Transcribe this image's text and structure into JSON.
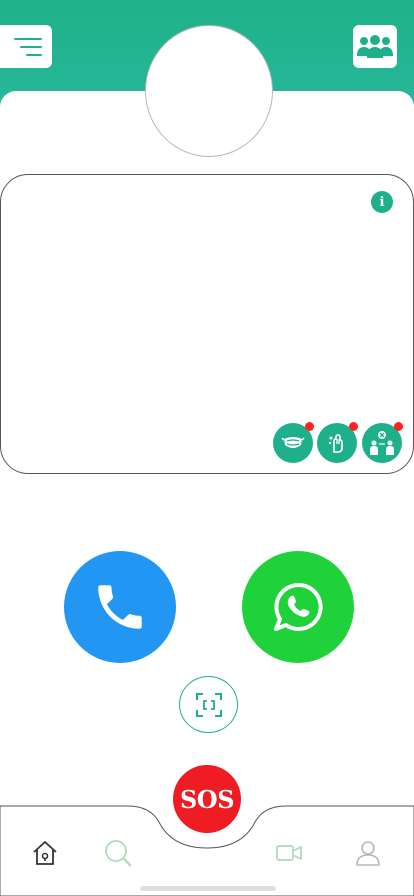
{
  "header": {
    "menu_icon": "menu-icon",
    "group_icon": "group-icon",
    "accent_color": "#1db08a"
  },
  "card": {
    "info_label": "i",
    "features": [
      {
        "icon": "mask-icon",
        "badge": "red-dot"
      },
      {
        "icon": "hand-wash-icon",
        "badge": "red-dot"
      },
      {
        "icon": "social-distance-icon",
        "badge": "red-dot"
      }
    ]
  },
  "actions": {
    "call_icon": "phone-icon",
    "call_color": "#2196f3",
    "whatsapp_icon": "whatsapp-icon",
    "whatsapp_color": "#1fd23a",
    "scan_icon": "scan-icon"
  },
  "bottom_nav": {
    "sos_label": "SOS",
    "sos_color": "#ef1c24",
    "items": [
      {
        "icon": "home-icon"
      },
      {
        "icon": "search-icon"
      },
      {
        "icon": "video-camera-icon"
      },
      {
        "icon": "profile-icon"
      }
    ]
  }
}
